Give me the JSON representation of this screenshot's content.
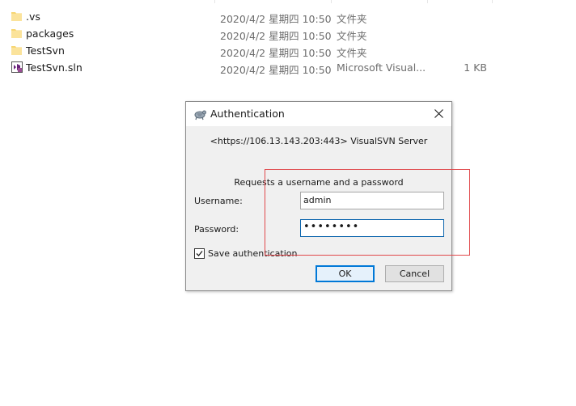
{
  "files": [
    {
      "name": ".vs",
      "date": "2020/4/2 星期四 10:50",
      "type": "文件夹",
      "size": "",
      "icon": "folder-icon"
    },
    {
      "name": "packages",
      "date": "2020/4/2 星期四 10:50",
      "type": "文件夹",
      "size": "",
      "icon": "folder-icon"
    },
    {
      "name": "TestSvn",
      "date": "2020/4/2 星期四 10:50",
      "type": "文件夹",
      "size": "",
      "icon": "folder-icon"
    },
    {
      "name": "TestSvn.sln",
      "date": "2020/4/2 星期四 10:50",
      "type": "Microsoft Visual...",
      "size": "1 KB",
      "icon": "visual-studio-solution-icon"
    }
  ],
  "dialog": {
    "title": "Authentication",
    "realm": "<https://106.13.143.203:443> VisualSVN Server",
    "prompt": "Requests a username and a password",
    "username_label": "Username:",
    "username_value": "admin",
    "password_label": "Password:",
    "password_value": "••••••••",
    "save_label": "Save authentication",
    "save_checked": true,
    "ok_label": "OK",
    "cancel_label": "Cancel"
  },
  "colors": {
    "folder": "#f7d673",
    "accent": "#0078d7",
    "annotation": "#e0484b"
  }
}
